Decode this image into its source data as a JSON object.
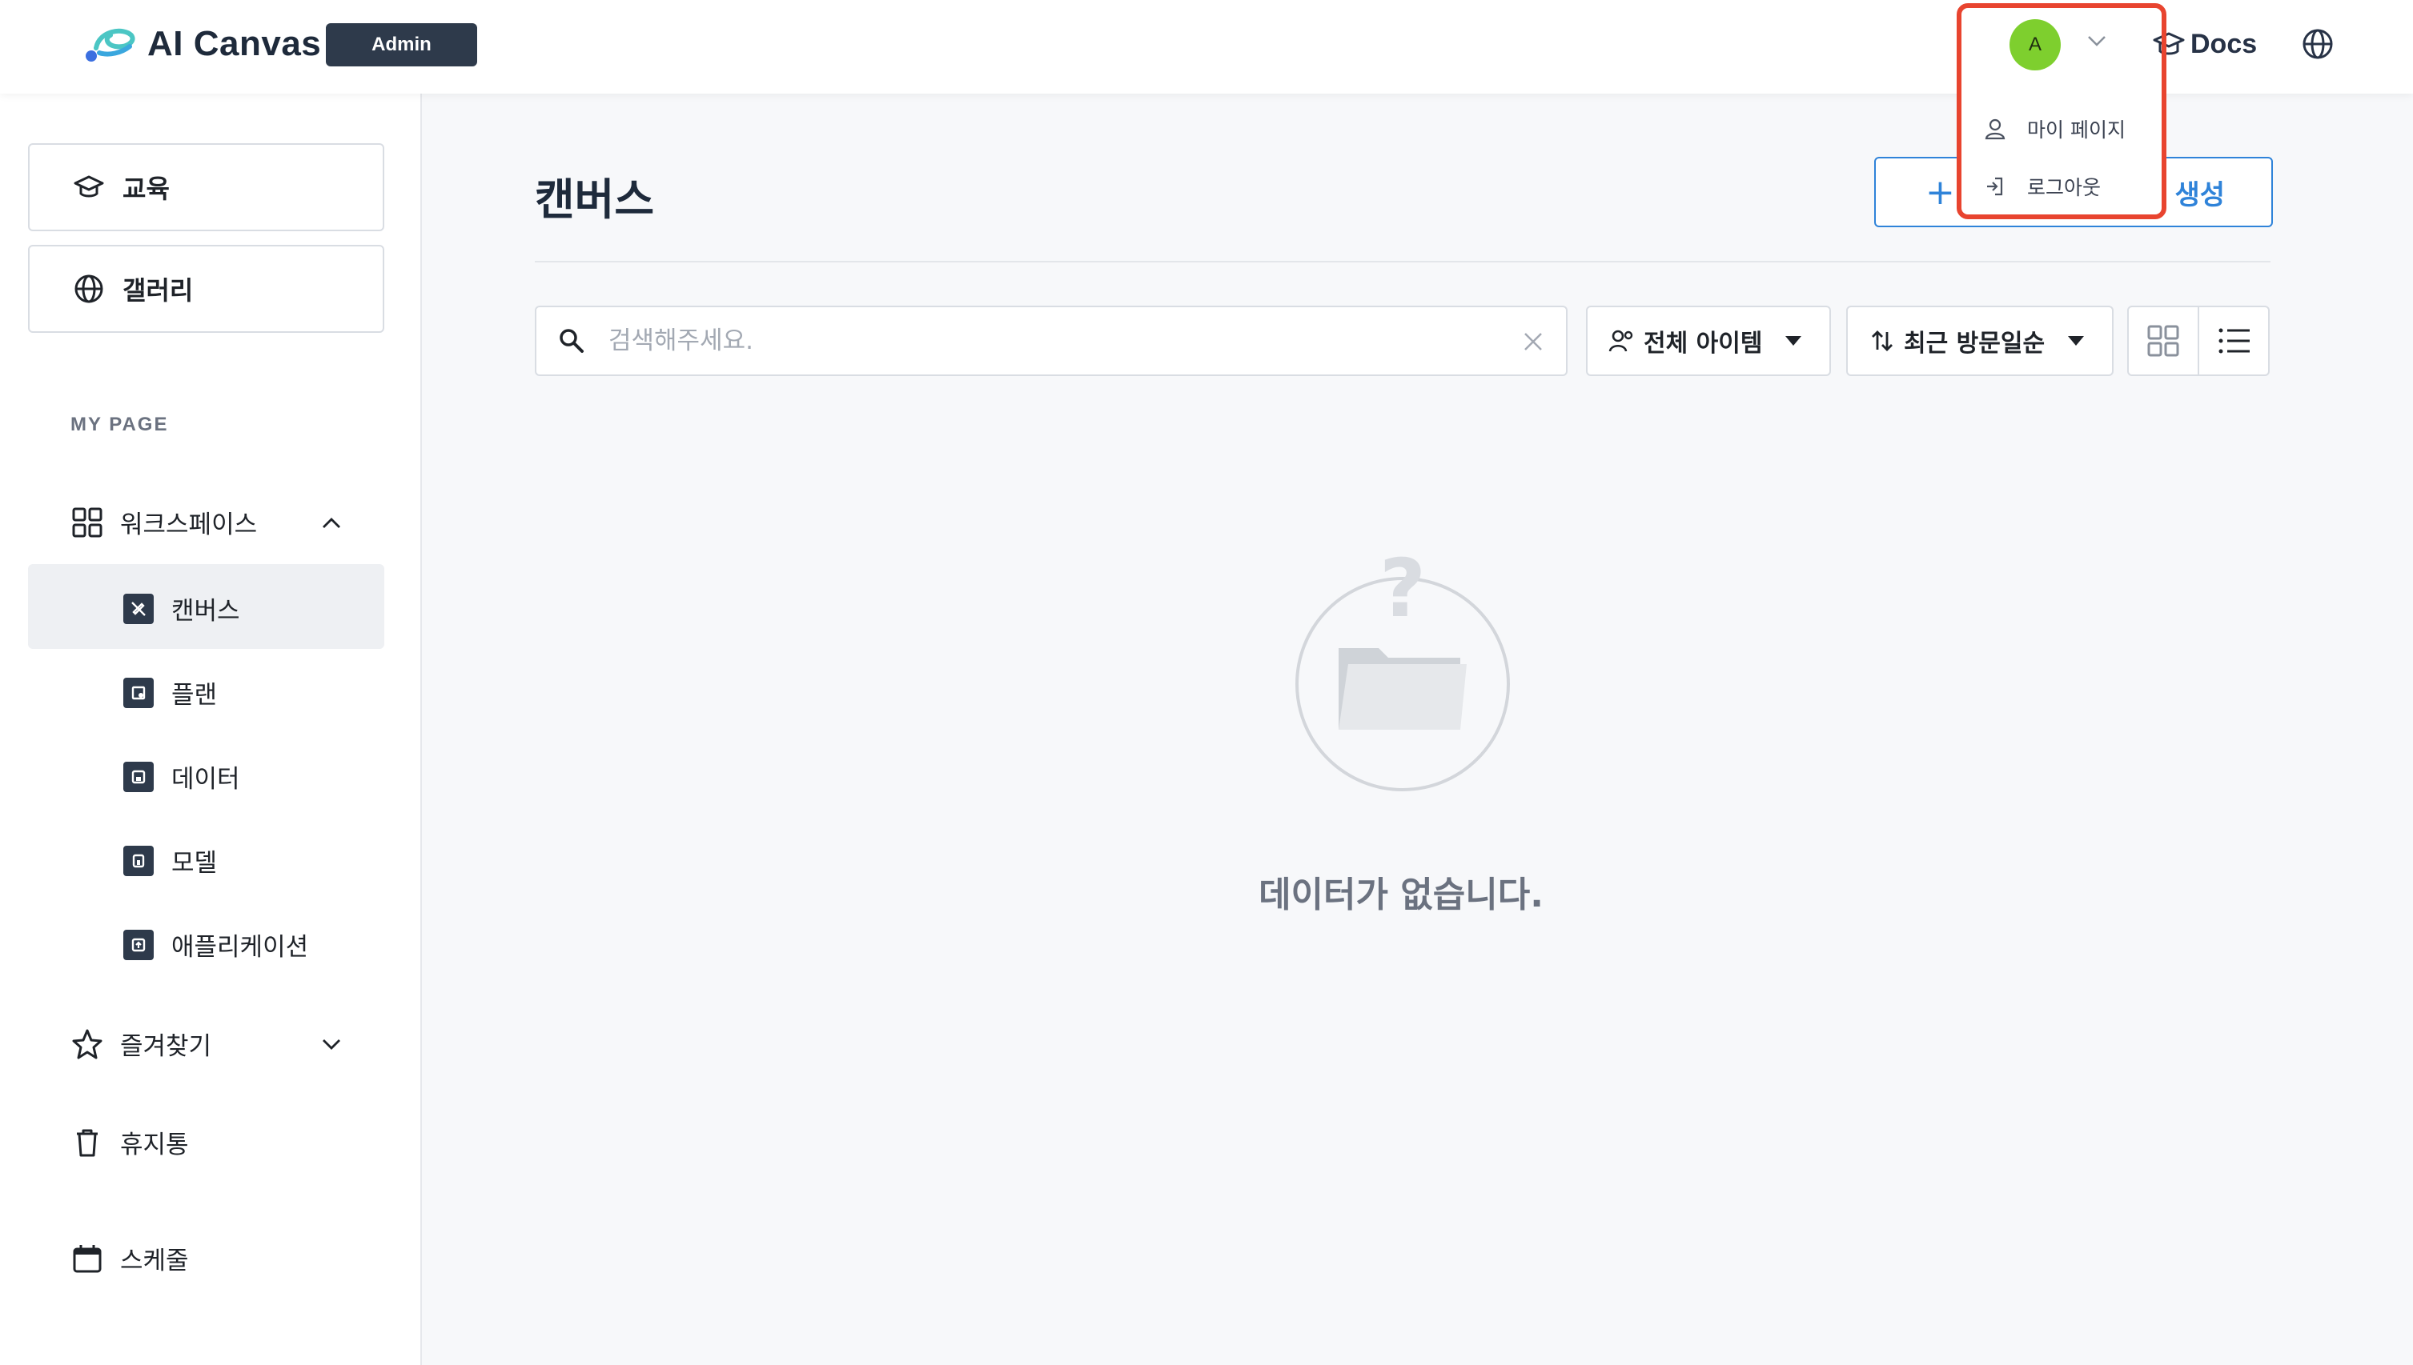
{
  "header": {
    "logo_text": "AI Canvas",
    "admin_badge": "Admin",
    "avatar_initial": "A",
    "docs_label": "Docs"
  },
  "user_menu": {
    "items": [
      {
        "label": "마이 페이지",
        "icon": "user-icon"
      },
      {
        "label": "로그아웃",
        "icon": "logout-icon"
      }
    ]
  },
  "sidebar": {
    "cards": [
      {
        "label": "교육",
        "icon": "graduation-cap-icon"
      },
      {
        "label": "갤러리",
        "icon": "globe-icon"
      }
    ],
    "section_title": "MY PAGE",
    "workspace": {
      "label": "워크스페이스",
      "expanded": true,
      "items": [
        {
          "label": "캔버스",
          "icon": "canvas-icon",
          "active": true
        },
        {
          "label": "플랜",
          "icon": "plan-icon"
        },
        {
          "label": "데이터",
          "icon": "data-icon"
        },
        {
          "label": "모델",
          "icon": "model-icon"
        },
        {
          "label": "애플리케이션",
          "icon": "application-icon"
        }
      ]
    },
    "favorites_label": "즐겨찾기",
    "trash_label": "휴지통",
    "schedule_label": "스케줄"
  },
  "main": {
    "title": "캔버스",
    "create_button_label": "생성",
    "search_placeholder": "검색해주세요.",
    "search_value": "",
    "filter_value": "전체 아이템",
    "sort_value": "최근 방문일순",
    "view_mode": "list",
    "empty_text": "데이터가 없습니다."
  },
  "colors": {
    "accent": "#2f83d9",
    "avatar": "#7ecf2e",
    "highlight_box": "#e8442f",
    "dark": "#2e3a4b"
  }
}
